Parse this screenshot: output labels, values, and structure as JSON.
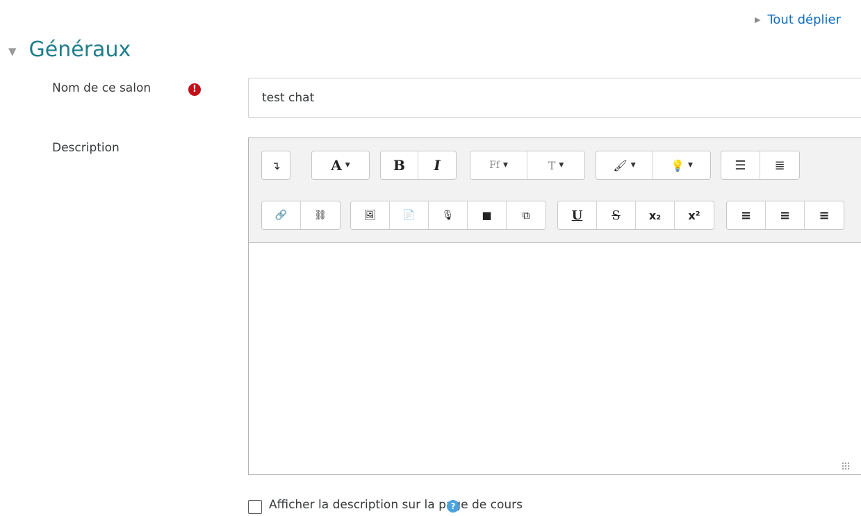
{
  "header": {
    "expand_all": "Tout déplier"
  },
  "section": {
    "title": "Généraux"
  },
  "form": {
    "name_label": "Nom de ce salon",
    "name_value": "test chat",
    "required_icon_glyph": "!",
    "description_label": "Description",
    "show_description_label": "Afficher la description sur la page de cours",
    "help_icon_glyph": "?"
  },
  "toolbar": {
    "row1": [
      {
        "name": "toggle-toolbar-button",
        "glyph": "↴"
      },
      {
        "name": "paragraph-style-button",
        "glyph": "A",
        "dropdown": true
      },
      {
        "name": "bold-button",
        "glyph": "B"
      },
      {
        "name": "italic-button",
        "glyph": "I"
      },
      {
        "name": "font-family-button",
        "glyph": "Ff",
        "dropdown": true
      },
      {
        "name": "font-size-button",
        "glyph": "T",
        "dropdown": true
      },
      {
        "name": "font-color-button",
        "glyph": "🖌",
        "dropdown": true
      },
      {
        "name": "highlight-button",
        "glyph": "💡",
        "dropdown": true
      },
      {
        "name": "unordered-list-button",
        "glyph": "☰"
      },
      {
        "name": "ordered-list-button",
        "glyph": "≣"
      }
    ],
    "row2": [
      {
        "name": "link-button",
        "glyph": "🔗"
      },
      {
        "name": "unlink-button",
        "glyph": "⛓"
      },
      {
        "name": "image-button",
        "glyph": "🖼"
      },
      {
        "name": "media-button",
        "glyph": "📄"
      },
      {
        "name": "record-audio-button",
        "glyph": "🎙"
      },
      {
        "name": "record-video-button",
        "glyph": "■"
      },
      {
        "name": "manage-files-button",
        "glyph": "⧉"
      },
      {
        "name": "underline-button",
        "glyph": "U"
      },
      {
        "name": "strikethrough-button",
        "glyph": "S"
      },
      {
        "name": "subscript-button",
        "glyph": "x₂"
      },
      {
        "name": "superscript-button",
        "glyph": "x²"
      },
      {
        "name": "align-left-button",
        "glyph": "≡"
      },
      {
        "name": "align-center-button",
        "glyph": "≡"
      },
      {
        "name": "align-right-button",
        "glyph": "≡"
      }
    ]
  },
  "colors": {
    "link": "#0f6cbf",
    "section_title": "#1f7e8a",
    "required": "#c1101a",
    "help": "#4aa3df"
  }
}
